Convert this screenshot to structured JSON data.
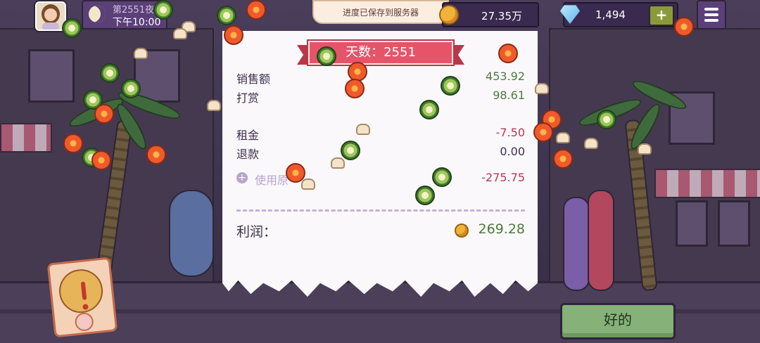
{
  "hud": {
    "day_label": "第2551夜",
    "time_label": "下午10:00",
    "toast": "进度已保存到服务器",
    "money": "27.35万",
    "gems": "1,494",
    "plus": "+"
  },
  "receipt": {
    "title": "天数：2551",
    "rows": [
      {
        "label": "销售额",
        "value": "453.92"
      },
      {
        "label": "打赏",
        "value": "98.61"
      },
      {
        "label": "租金",
        "value": "-7.50"
      },
      {
        "label": "退款",
        "value": "0.00"
      },
      {
        "label": "使用原",
        "value": "-275.75"
      }
    ],
    "profit_label": "利润：",
    "profit_value": "269.28"
  },
  "ok_button": "好的",
  "colors": {
    "positive": "#4d7a3f",
    "negative": "#b23a52",
    "ribbon": "#e6546a",
    "button": "#86b179"
  },
  "icons": [
    "moon-icon",
    "coin-icon",
    "gem-icon",
    "menu-icon",
    "plus-icon",
    "alert-icon",
    "add-circle-icon"
  ]
}
